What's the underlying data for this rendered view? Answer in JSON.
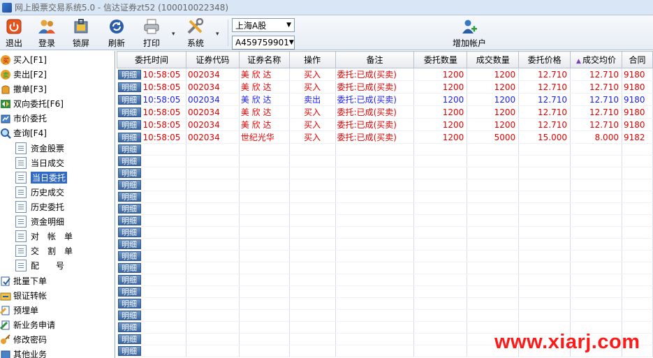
{
  "window": {
    "title": "网上股票交易系统5.0 - 信达证券zt52 (100010022348)"
  },
  "toolbar": {
    "exit_label": "退出",
    "login_label": "登录",
    "lock_label": "锁屏",
    "refresh_label": "刷新",
    "print_label": "打印",
    "system_label": "系统",
    "market_select": "上海A股",
    "account_select": "A459759901",
    "add_account_label": "增加帐户"
  },
  "sidebar": {
    "items": [
      {
        "label": "买入[F1]",
        "icon": "buy-icon"
      },
      {
        "label": "卖出[F2]",
        "icon": "sell-icon"
      },
      {
        "label": "撤单[F3]",
        "icon": "cancel-order-icon"
      },
      {
        "label": "双向委托[F6]",
        "icon": "bidirectional-icon"
      },
      {
        "label": "市价委托",
        "icon": "market-order-icon"
      },
      {
        "label": "查询[F4]",
        "icon": "query-icon"
      }
    ],
    "query_items": [
      {
        "label": "资金股票"
      },
      {
        "label": "当日成交"
      },
      {
        "label": "当日委托"
      },
      {
        "label": "历史成交"
      },
      {
        "label": "历史委托"
      },
      {
        "label": "资金明细"
      },
      {
        "label": "对　帐　单"
      },
      {
        "label": "交　割　单"
      },
      {
        "label": "配　　号"
      }
    ],
    "bottom_items": [
      {
        "label": "批量下单"
      },
      {
        "label": "银证转帐"
      },
      {
        "label": "预埋单"
      },
      {
        "label": "新业务申请"
      },
      {
        "label": "修改密码"
      },
      {
        "label": "其他业务"
      }
    ]
  },
  "table": {
    "detail_label": "明细",
    "columns": [
      "委托时间",
      "证券代码",
      "证券名称",
      "操作",
      "备注",
      "委托数量",
      "成交数量",
      "委托价格",
      "成交均价",
      "合同"
    ],
    "rows": [
      {
        "time": "10:58:05",
        "code": "002034",
        "name": "美 欣 达",
        "op": "买入",
        "remark": "委托:已成(买卖)",
        "qty": "1200",
        "filled": "1200",
        "price": "12.710",
        "avg": "12.710",
        "contract": "9180",
        "color": "red"
      },
      {
        "time": "10:58:05",
        "code": "002034",
        "name": "美 欣 达",
        "op": "买入",
        "remark": "委托:已成(买卖)",
        "qty": "1200",
        "filled": "1200",
        "price": "12.710",
        "avg": "12.710",
        "contract": "9180",
        "color": "red"
      },
      {
        "time": "10:58:05",
        "code": "002034",
        "name": "美 欣 达",
        "op": "卖出",
        "remark": "委托:已成(买卖)",
        "qty": "1200",
        "filled": "1200",
        "price": "12.710",
        "avg": "12.710",
        "contract": "9180",
        "color": "blue"
      },
      {
        "time": "10:58:05",
        "code": "002034",
        "name": "美 欣 达",
        "op": "买入",
        "remark": "委托:已成(买卖)",
        "qty": "1200",
        "filled": "1200",
        "price": "12.710",
        "avg": "12.710",
        "contract": "9180",
        "color": "red"
      },
      {
        "time": "10:58:05",
        "code": "002034",
        "name": "美 欣 达",
        "op": "买入",
        "remark": "委托:已成(买卖)",
        "qty": "1200",
        "filled": "1200",
        "price": "12.710",
        "avg": "12.710",
        "contract": "9180",
        "color": "red"
      },
      {
        "time": "10:58:05",
        "code": "002034",
        "name": "世纪光华",
        "op": "买入",
        "remark": "委托:已成(买卖)",
        "qty": "1200",
        "filled": "5000",
        "price": "15.000",
        "avg": "8.000",
        "contract": "9182",
        "color": "red"
      }
    ],
    "empty_rows": 18
  },
  "watermark": "www.xiarj.com",
  "colors": {
    "buy": "#e60000",
    "sell": "#1a1aff",
    "selected": "#316ac5"
  }
}
